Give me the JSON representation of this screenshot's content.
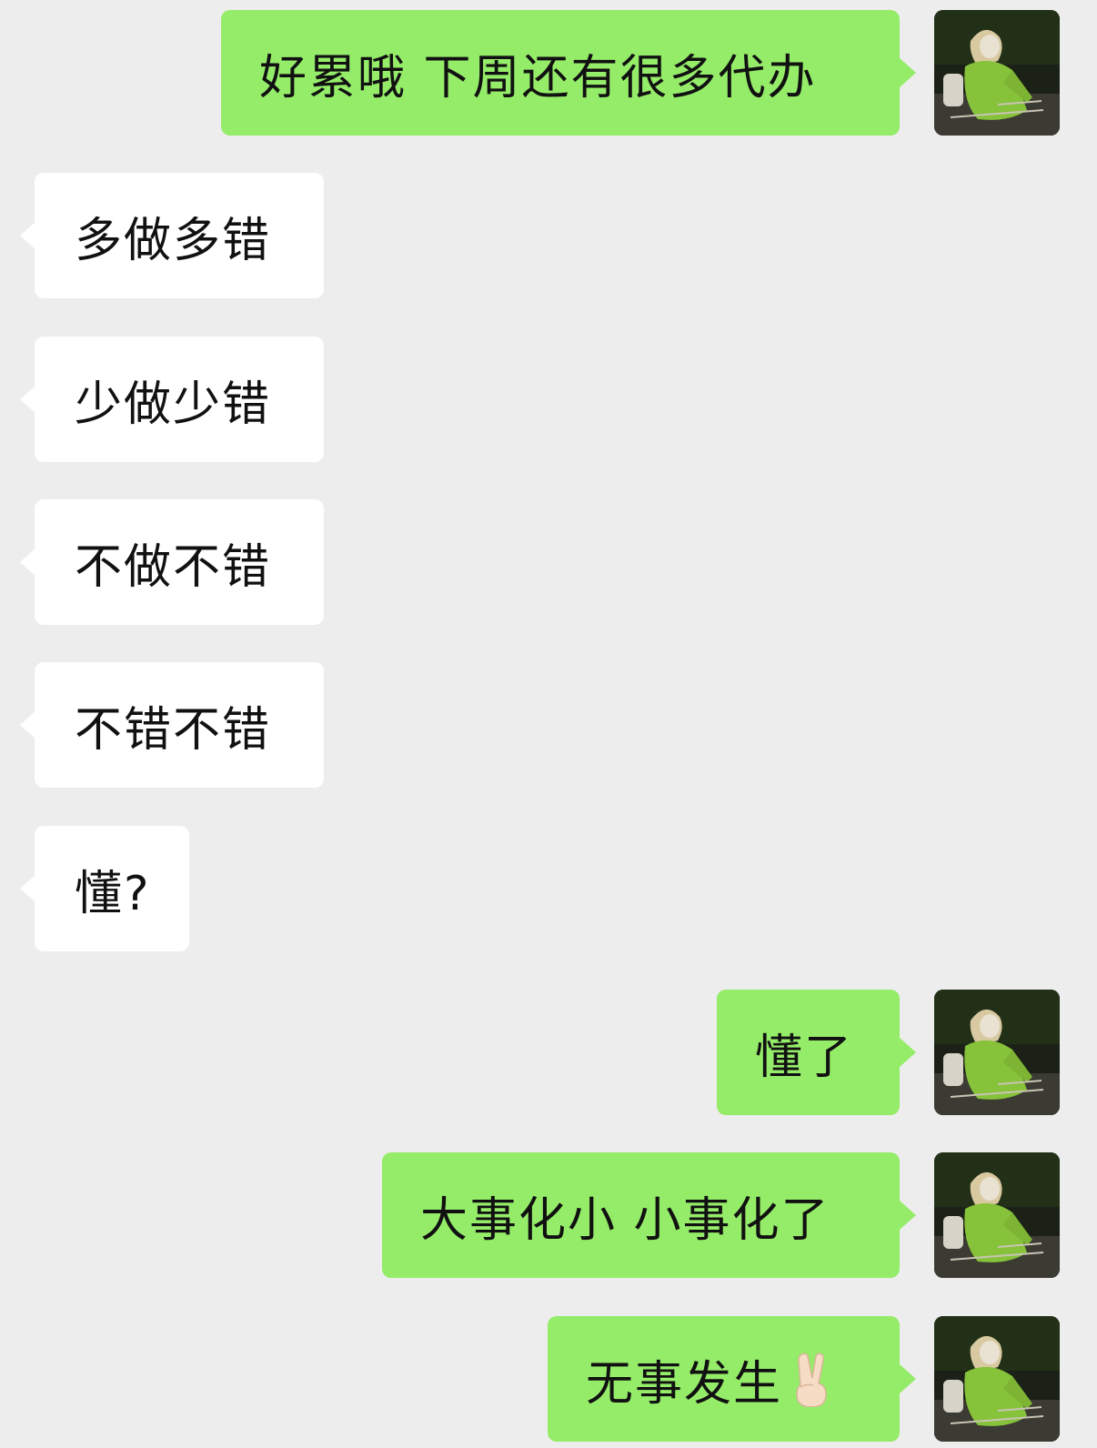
{
  "messages": [
    {
      "side": "outgoing",
      "text": "好累哦 下周还有很多代办"
    },
    {
      "side": "incoming",
      "text": "多做多错"
    },
    {
      "side": "incoming",
      "text": "少做少错"
    },
    {
      "side": "incoming",
      "text": "不做不错"
    },
    {
      "side": "incoming",
      "text": "不错不错"
    },
    {
      "side": "incoming",
      "text": "懂?"
    },
    {
      "side": "outgoing",
      "text": "懂了"
    },
    {
      "side": "outgoing",
      "text": "大事化小 小事化了"
    },
    {
      "side": "outgoing",
      "text": "无事发生",
      "emoji": "victory-hand-icon"
    }
  ],
  "colors": {
    "background": "#ededed",
    "outgoing_bubble": "#95ec69",
    "incoming_bubble": "#ffffff",
    "text": "#111111"
  }
}
